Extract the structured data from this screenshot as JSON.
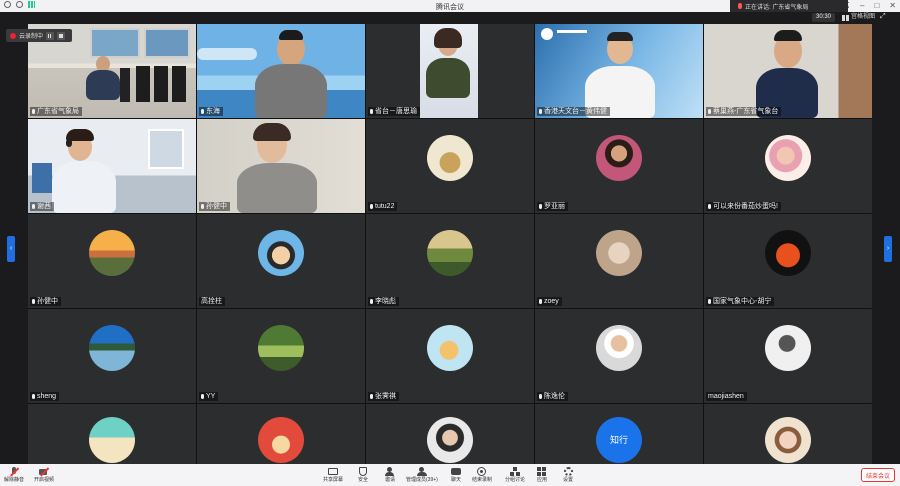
{
  "window": {
    "title": "腾讯会议"
  },
  "speaking": {
    "label": "正在讲话: 广东省气象局"
  },
  "topbar": {
    "timer": "30:30",
    "gallery_label": "宫格视图"
  },
  "recording": {
    "label": "云录制中"
  },
  "participants": [
    {
      "name": "广东省气象局",
      "type": "video",
      "scene": "office"
    },
    {
      "name": "东海",
      "type": "video",
      "scene": "sky"
    },
    {
      "name": "省台－唐思瑜",
      "type": "video",
      "scene": "woman1"
    },
    {
      "name": "香港天文台－黄伟健",
      "type": "video",
      "scene": "hko"
    },
    {
      "name": "蔡巢燕-广东省气象台",
      "type": "video",
      "scene": "man2"
    },
    {
      "name": "谢茜",
      "type": "video",
      "scene": "woman2"
    },
    {
      "name": "孙健中",
      "type": "video",
      "scene": "woman3"
    },
    {
      "name": "tutu22",
      "type": "avatar",
      "scene": "av-light"
    },
    {
      "name": "罗亚丽",
      "type": "avatar",
      "scene": "av-woman"
    },
    {
      "name": "可以来份番茄炒蛋吗!",
      "type": "avatar",
      "scene": "av-child"
    },
    {
      "name": "孙健中",
      "type": "avatar",
      "scene": "av-sunset"
    },
    {
      "name": "高拴柱",
      "type": "avatar",
      "scene": "av-cartoon"
    },
    {
      "name": "李晓彪",
      "type": "avatar",
      "scene": "av-hill"
    },
    {
      "name": "zoey",
      "type": "avatar",
      "scene": "av-dog"
    },
    {
      "name": "国家气象中心-胡宁",
      "type": "avatar",
      "scene": "av-fruit"
    },
    {
      "name": "sheng",
      "type": "avatar",
      "scene": "av-lake"
    },
    {
      "name": "YY",
      "type": "avatar",
      "scene": "av-green"
    },
    {
      "name": "张霁祺",
      "type": "avatar",
      "scene": "av-fish"
    },
    {
      "name": "陈逸伦",
      "type": "avatar",
      "scene": "av-man"
    },
    {
      "name": "maojiashen",
      "type": "avatar",
      "scene": "av-sketch"
    },
    {
      "name": "",
      "type": "avatar",
      "scene": "av-beach"
    },
    {
      "name": "",
      "type": "avatar",
      "scene": "av-red"
    },
    {
      "name": "",
      "type": "avatar",
      "scene": "av-girl"
    },
    {
      "name": "",
      "type": "avatar-text",
      "scene": "av-text",
      "avatar_text": "知行"
    },
    {
      "name": "",
      "type": "avatar",
      "scene": "av-anime"
    }
  ],
  "toolbar": {
    "left": [
      {
        "label": "解除静音",
        "icon": "mic-muted-icon"
      },
      {
        "label": "开启视频",
        "icon": "camera-off-icon"
      }
    ],
    "center": [
      {
        "label": "共享屏幕",
        "icon": "share-screen-icon"
      },
      {
        "label": "安全",
        "icon": "shield-icon"
      },
      {
        "label": "邀请",
        "icon": "invite-icon"
      },
      {
        "label": "管理成员(39+)",
        "icon": "members-icon"
      },
      {
        "label": "聊天",
        "icon": "chat-icon"
      },
      {
        "label": "结束录制",
        "icon": "record-icon"
      },
      {
        "label": "分组讨论",
        "icon": "breakout-icon"
      },
      {
        "label": "应用",
        "icon": "apps-icon"
      },
      {
        "label": "设置",
        "icon": "gear-icon"
      }
    ],
    "end_label": "结束会议"
  },
  "colors": {
    "accent": "#1f6fe0",
    "end": "#e33333",
    "record": "#e22233"
  }
}
